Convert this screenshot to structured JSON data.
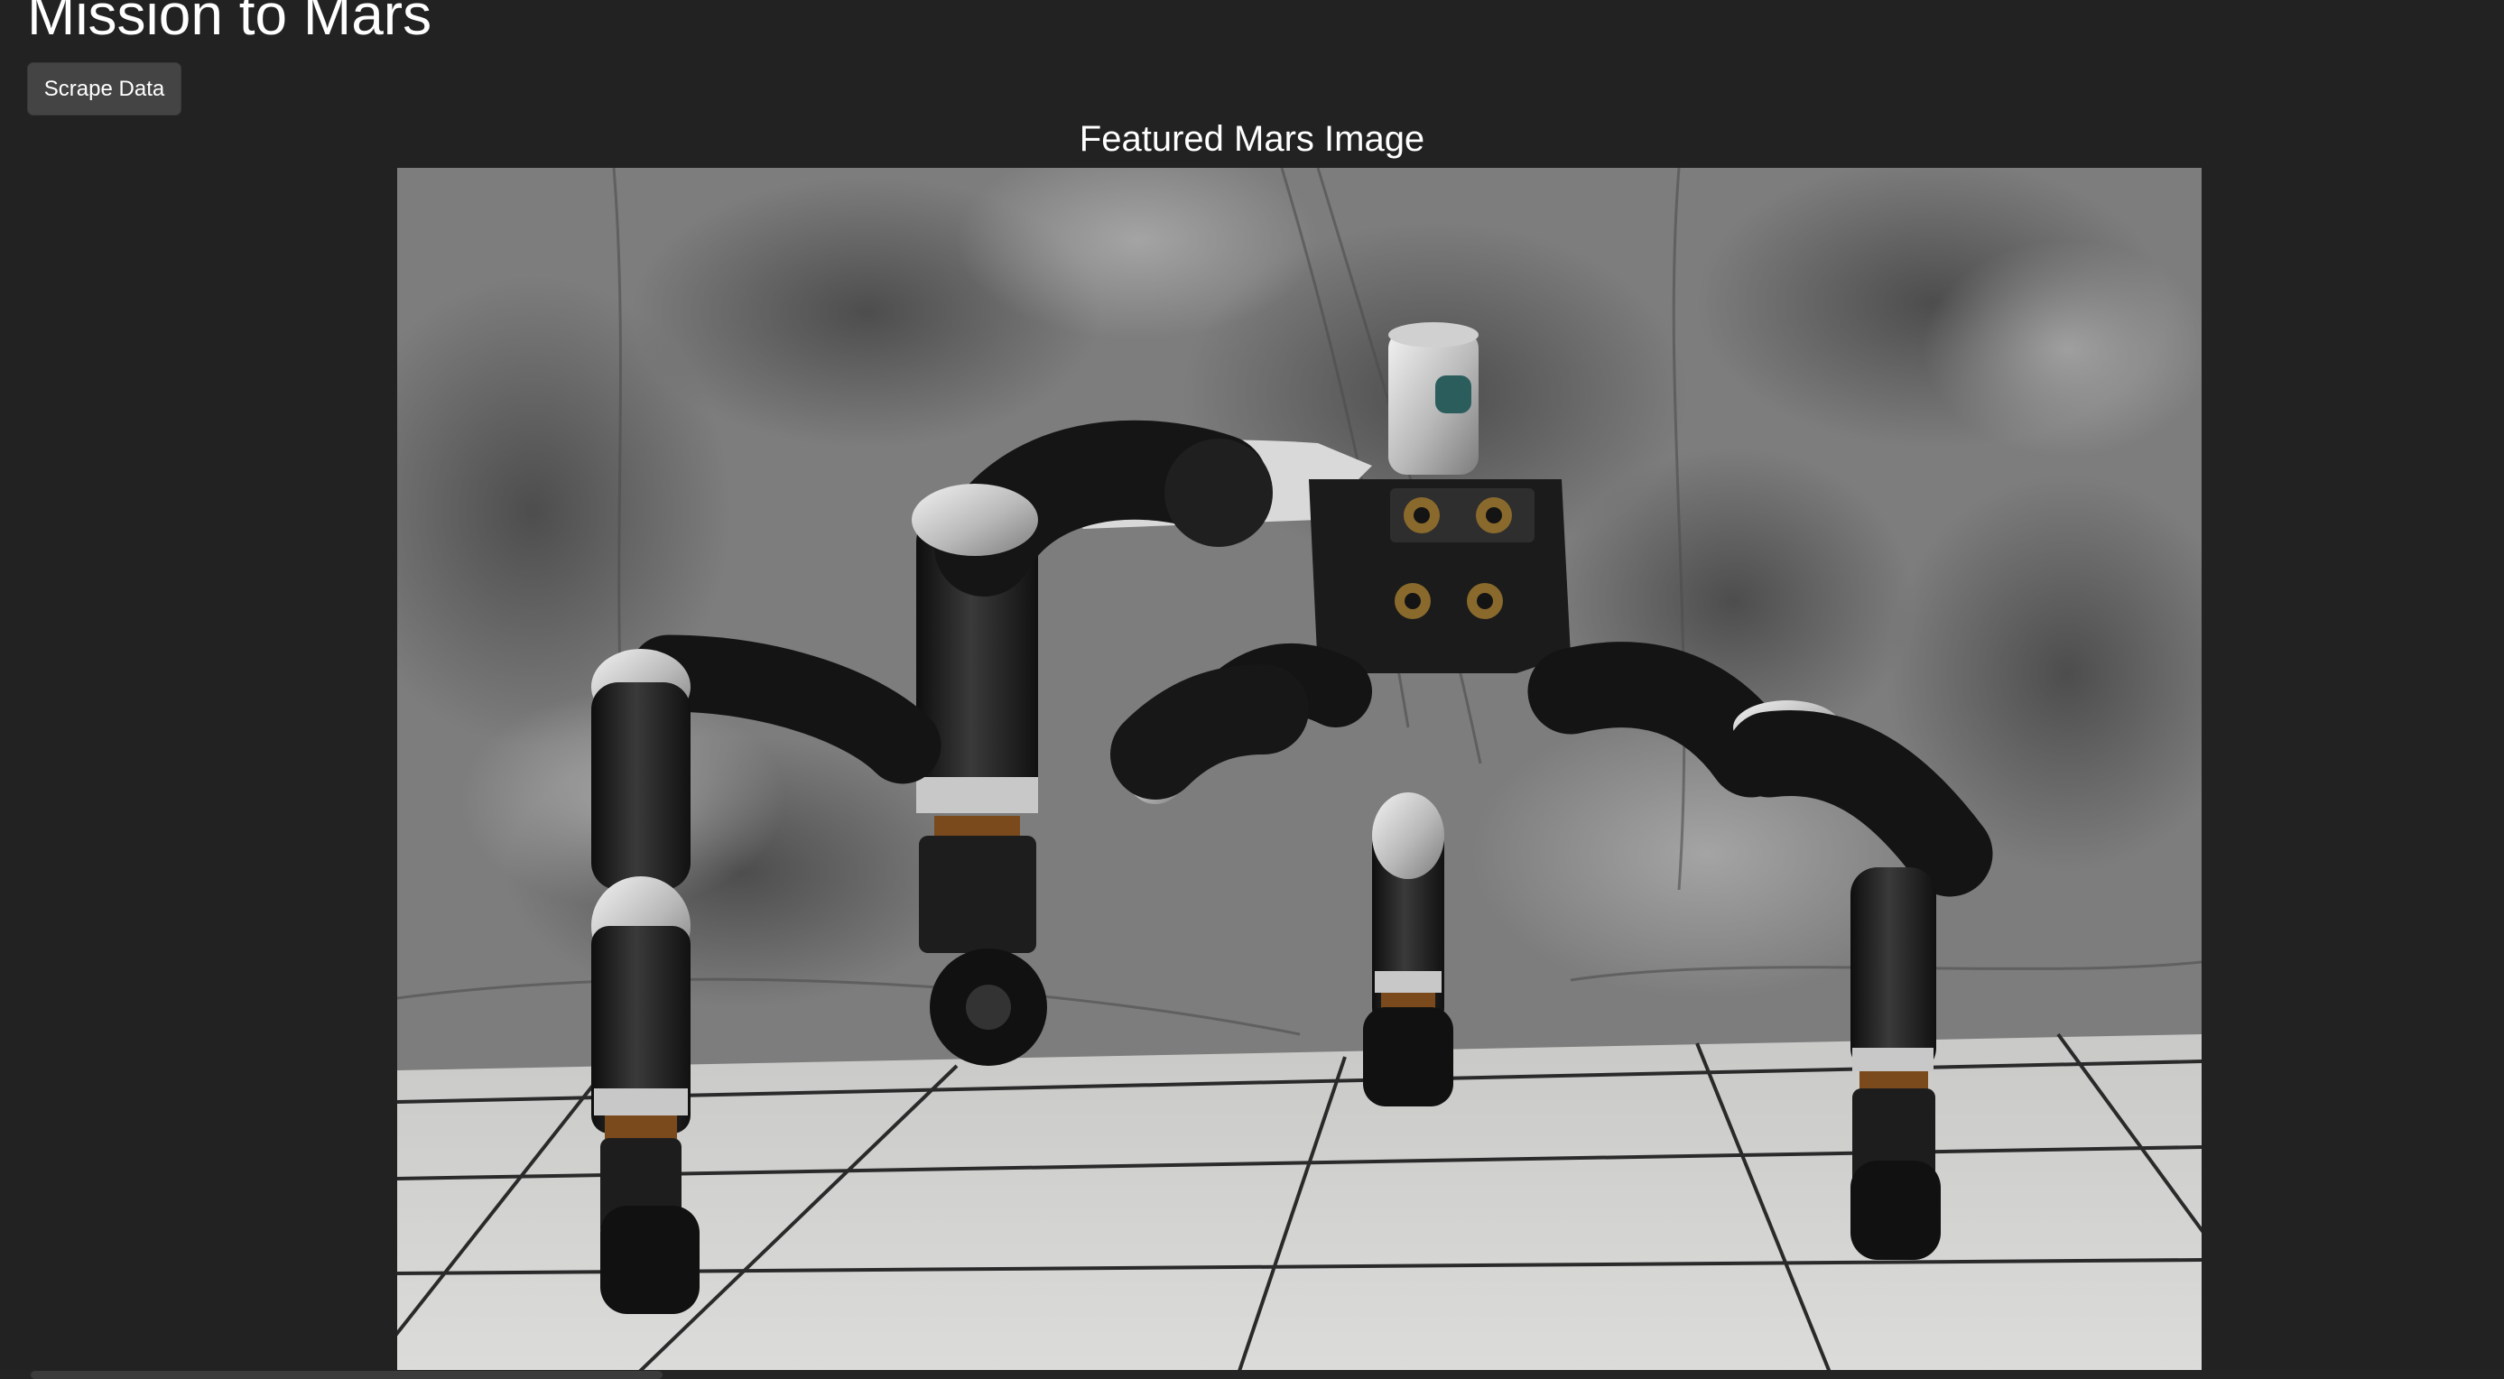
{
  "page": {
    "title": "Mission to Mars"
  },
  "controls": {
    "scrape_button_label": "Scrape Data"
  },
  "featured_image": {
    "heading": "Featured Mars Image",
    "alt": "Featured Mars Image"
  },
  "colors": {
    "background": "#222222",
    "button": "#444444",
    "text": "#ffffff"
  }
}
